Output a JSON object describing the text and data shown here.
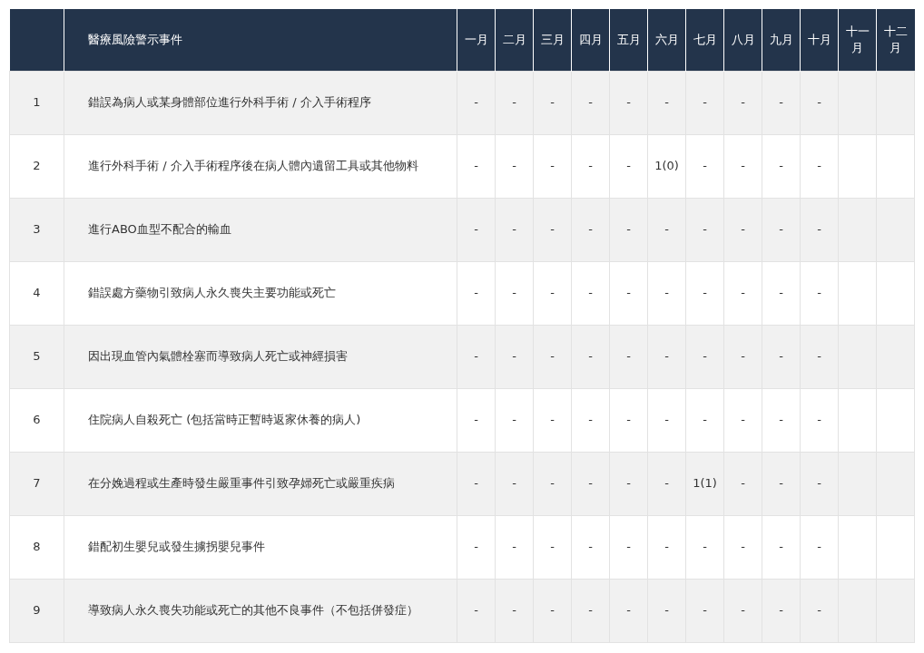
{
  "table": {
    "columns": [
      "醫療風險警示事件",
      "一月",
      "二月",
      "三月",
      "四月",
      "五月",
      "六月",
      "七月",
      "八月",
      "九月",
      "十月",
      "十一月",
      "十二月"
    ],
    "rows": [
      {
        "number": "1",
        "event": "錯誤為病人或某身體部位進行外科手術 / 介入手術程序",
        "months": [
          "-",
          "-",
          "-",
          "-",
          "-",
          "-",
          "-",
          "-",
          "-",
          "-"
        ]
      },
      {
        "number": "2",
        "event": "進行外科手術 / 介入手術程序後在病人體內遺留工具或其他物料",
        "months": [
          "-",
          "-",
          "-",
          "-",
          "-",
          "1(0)",
          "-",
          "-",
          "-",
          "-"
        ]
      },
      {
        "number": "3",
        "event": "進行ABO血型不配合的輸血",
        "months": [
          "-",
          "-",
          "-",
          "-",
          "-",
          "-",
          "-",
          "-",
          "-",
          "-"
        ]
      },
      {
        "number": "4",
        "event": "錯誤處方藥物引致病人永久喪失主要功能或死亡",
        "months": [
          "-",
          "-",
          "-",
          "-",
          "-",
          "-",
          "-",
          "-",
          "-",
          "-"
        ]
      },
      {
        "number": "5",
        "event": "因出現血管內氣體栓塞而導致病人死亡或神經損害",
        "months": [
          "-",
          "-",
          "-",
          "-",
          "-",
          "-",
          "-",
          "-",
          "-",
          "-"
        ]
      },
      {
        "number": "6",
        "event": "住院病人自殺死亡 (包括當時正暫時返家休養的病人)",
        "months": [
          "-",
          "-",
          "-",
          "-",
          "-",
          "-",
          "-",
          "-",
          "-",
          "-"
        ]
      },
      {
        "number": "7",
        "event": "在分娩過程或生產時發生嚴重事件引致孕婦死亡或嚴重疾病",
        "months": [
          "-",
          "-",
          "-",
          "-",
          "-",
          "-",
          "1(1)",
          "-",
          "-",
          "-"
        ]
      },
      {
        "number": "8",
        "event": "錯配初生嬰兒或發生擄拐嬰兒事件",
        "months": [
          "-",
          "-",
          "-",
          "-",
          "-",
          "-",
          "-",
          "-",
          "-",
          "-"
        ]
      },
      {
        "number": "9",
        "event": "導致病人永久喪失功能或死亡的其他不良事件（不包括併發症）",
        "months": [
          "-",
          "-",
          "-",
          "-",
          "-",
          "-",
          "-",
          "-",
          "-",
          "-"
        ]
      }
    ]
  }
}
